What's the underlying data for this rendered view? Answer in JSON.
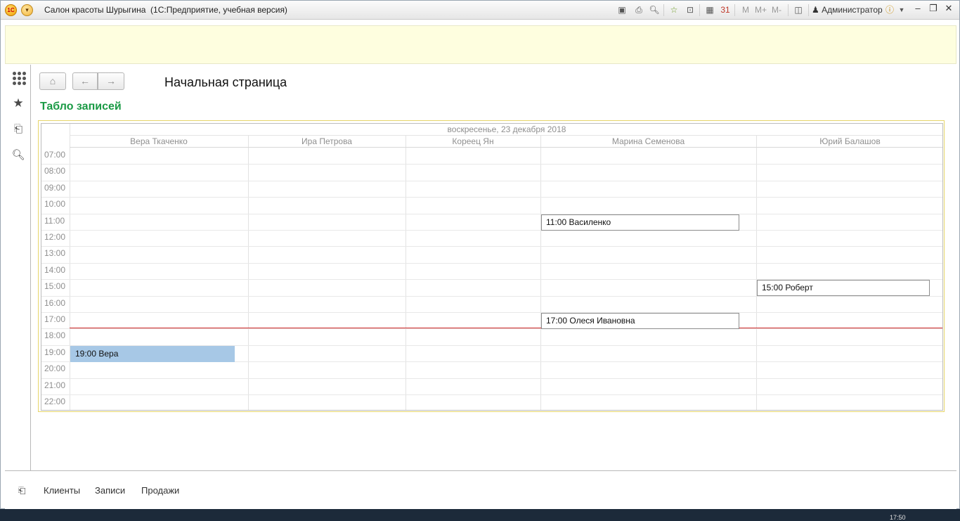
{
  "window": {
    "title": "Салон красоты Шурыгина  (1С:Предприятие, учебная версия)",
    "user": "Администратор",
    "m_labels": [
      "M",
      "M+",
      "M-"
    ]
  },
  "nav": {
    "page_title": "Начальная страница"
  },
  "board": {
    "title": "Табло записей",
    "date": "воскресенье, 23 декабря 2018",
    "columns": [
      "Вера Ткаченко",
      "Ира Петрова",
      "Кореец Ян",
      "Марина Семенова",
      "Юрий Балашов"
    ],
    "hours": [
      "07:00",
      "08:00",
      "09:00",
      "10:00",
      "11:00",
      "12:00",
      "13:00",
      "14:00",
      "15:00",
      "16:00",
      "17:00",
      "18:00",
      "19:00",
      "20:00",
      "21:00",
      "22:00"
    ],
    "events": [
      {
        "label": "11:00 Василенко",
        "master": "Марина Семенова",
        "hour": "11:00",
        "selected": false
      },
      {
        "label": "15:00 Роберт",
        "master": "Юрий Балашов",
        "hour": "15:00",
        "selected": false
      },
      {
        "label": "17:00 Олеся Ивановна",
        "master": "Марина Семенова",
        "hour": "17:00",
        "selected": false
      },
      {
        "label": "19:00 Вера",
        "master": "Вера Ткаченко",
        "hour": "19:00",
        "selected": true
      }
    ]
  },
  "bottom": {
    "links": [
      "Клиенты",
      "Записи",
      "Продажи"
    ]
  },
  "taskbar": {
    "clock": "17:50"
  },
  "colors": {
    "section_title": "#1a9a45",
    "now_line": "#cc2222",
    "selected_event": "#a7c8e6",
    "banner": "#fefedf"
  }
}
